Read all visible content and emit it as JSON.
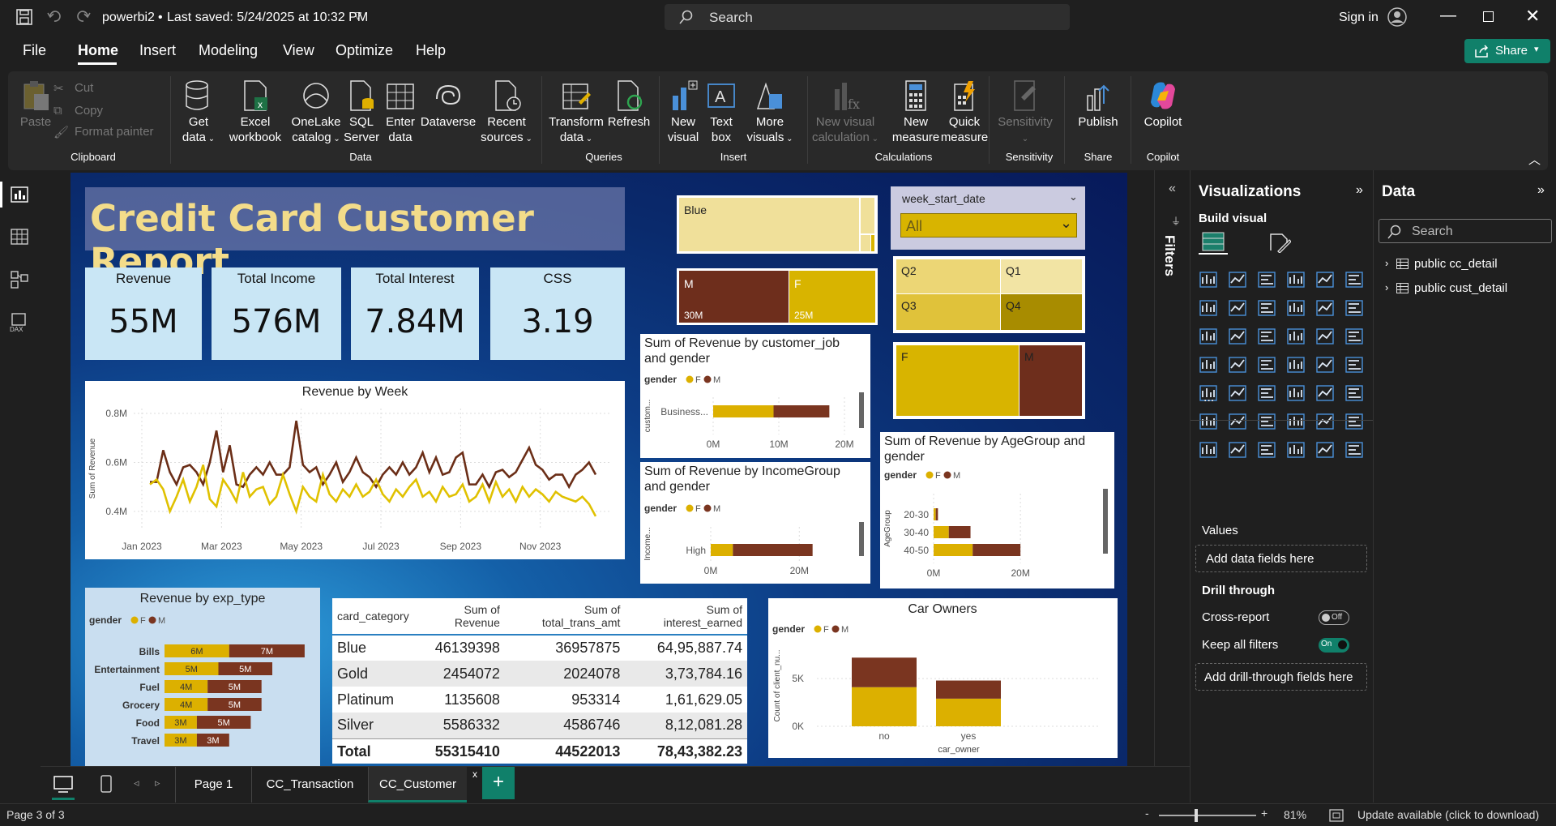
{
  "titlebar": {
    "file_name": "powerbi2",
    "saved": "Last saved: 5/24/2025 at 10:32 PM",
    "search_placeholder": "Search",
    "sign_in": "Sign in"
  },
  "menu": {
    "items": [
      "File",
      "Home",
      "Insert",
      "Modeling",
      "View",
      "Optimize",
      "Help"
    ],
    "active": "Home",
    "share": "Share"
  },
  "ribbon": {
    "clipboard": {
      "paste": "Paste",
      "cut": "Cut",
      "copy": "Copy",
      "format_painter": "Format painter",
      "group": "Clipboard"
    },
    "data": {
      "get_data_1": "Get",
      "get_data_2": "data",
      "excel_1": "Excel",
      "excel_2": "workbook",
      "onelake_1": "OneLake",
      "onelake_2": "catalog",
      "sql_1": "SQL",
      "sql_2": "Server",
      "enter_1": "Enter",
      "enter_2": "data",
      "dataverse": "Dataverse",
      "recent_1": "Recent",
      "recent_2": "sources",
      "group": "Data"
    },
    "queries": {
      "transform_1": "Transform",
      "transform_2": "data",
      "refresh": "Refresh",
      "group": "Queries"
    },
    "insert": {
      "new_visual_1": "New",
      "new_visual_2": "visual",
      "text_box_1": "Text",
      "text_box_2": "box",
      "more_1": "More",
      "more_2": "visuals",
      "group": "Insert"
    },
    "calculations": {
      "nvc_1": "New visual",
      "nvc_2": "calculation",
      "nm_1": "New",
      "nm_2": "measure",
      "qm_1": "Quick",
      "qm_2": "measure",
      "group": "Calculations"
    },
    "sensitivity": {
      "label": "Sensitivity",
      "group": "Sensitivity"
    },
    "share": {
      "publish": "Publish",
      "group": "Share"
    },
    "copilot": {
      "label": "Copilot",
      "group": "Copilot"
    }
  },
  "report": {
    "title": "Credit Card Customer Report",
    "cards": [
      {
        "label": "Revenue",
        "value": "55M"
      },
      {
        "label": "Total Income",
        "value": "576M"
      },
      {
        "label": "Total Interest",
        "value": "7.84M"
      },
      {
        "label": "CSS",
        "value": "3.19"
      }
    ],
    "slicer": {
      "title": "week_start_date",
      "value": "All"
    },
    "treemap_card": {
      "label": "Blue"
    },
    "treemap_gender": {
      "m_label": "M",
      "m_value": "30M",
      "f_label": "F",
      "f_value": "25M"
    },
    "treemap_quarter": {
      "q2": "Q2",
      "q1": "Q1",
      "q3": "Q3",
      "q4": "Q4"
    },
    "treemap_gender2": {
      "f": "F",
      "m": "M"
    },
    "legend": {
      "label": "gender",
      "f": "F",
      "m": "M"
    }
  },
  "chart_data": [
    {
      "type": "line",
      "title": "Revenue by Week",
      "xlabel": "",
      "ylabel": "Sum of Revenue",
      "x_ticks": [
        "Jan 2023",
        "Mar 2023",
        "May 2023",
        "Jul 2023",
        "Sep 2023",
        "Nov 2023"
      ],
      "y_ticks": [
        "0.4M",
        "0.6M",
        "0.8M"
      ],
      "ylim": [
        0.33,
        0.82
      ],
      "series": [
        {
          "name": "M",
          "color": "#6b2e17",
          "values": [
            0.52,
            0.52,
            0.65,
            0.56,
            0.51,
            0.58,
            0.59,
            0.56,
            0.51,
            0.6,
            0.73,
            0.56,
            0.67,
            0.51,
            0.5,
            0.55,
            0.58,
            0.55,
            0.6,
            0.55,
            0.55,
            0.58,
            0.77,
            0.59,
            0.56,
            0.58,
            0.51,
            0.55,
            0.6,
            0.52,
            0.56,
            0.62,
            0.56,
            0.54,
            0.5,
            0.55,
            0.58,
            0.55,
            0.6,
            0.55,
            0.58,
            0.64,
            0.56,
            0.62,
            0.55,
            0.56,
            0.62,
            0.64,
            0.51,
            0.51,
            0.55,
            0.5,
            0.56,
            0.57,
            0.54,
            0.56,
            0.61,
            0.66,
            0.59,
            0.57,
            0.53,
            0.55,
            0.55,
            0.5,
            0.55,
            0.57,
            0.6,
            0.55
          ]
        },
        {
          "name": "F",
          "color": "#e0c100",
          "values": [
            0.51,
            0.53,
            0.49,
            0.4,
            0.46,
            0.53,
            0.44,
            0.5,
            0.59,
            0.45,
            0.42,
            0.53,
            0.49,
            0.44,
            0.56,
            0.46,
            0.49,
            0.5,
            0.43,
            0.46,
            0.55,
            0.47,
            0.4,
            0.5,
            0.46,
            0.44,
            0.55,
            0.47,
            0.44,
            0.49,
            0.46,
            0.51,
            0.46,
            0.48,
            0.53,
            0.47,
            0.44,
            0.49,
            0.46,
            0.5,
            0.53,
            0.46,
            0.48,
            0.44,
            0.5,
            0.46,
            0.47,
            0.51,
            0.44,
            0.46,
            0.51,
            0.44,
            0.52,
            0.46,
            0.49,
            0.44,
            0.5,
            0.46,
            0.49,
            0.47,
            0.44,
            0.48,
            0.46,
            0.45,
            0.44,
            0.46,
            0.43,
            0.38
          ]
        }
      ]
    },
    {
      "type": "bar",
      "title": "Sum of Revenue by customer_job and gender",
      "ylabel": "custom...",
      "categories": [
        "Business..."
      ],
      "x_ticks": [
        "0M",
        "10M",
        "20M"
      ],
      "xlim": [
        0,
        20
      ],
      "series": [
        {
          "name": "F",
          "values": [
            9.2
          ]
        },
        {
          "name": "M",
          "values": [
            8.5
          ]
        }
      ]
    },
    {
      "type": "bar",
      "title": "Sum of Revenue by IncomeGroup and gender",
      "ylabel": "Income...",
      "categories": [
        "High"
      ],
      "x_ticks": [
        "0M",
        "20M"
      ],
      "xlim": [
        0,
        28
      ],
      "series": [
        {
          "name": "F",
          "values": [
            5
          ]
        },
        {
          "name": "M",
          "values": [
            18
          ]
        }
      ]
    },
    {
      "type": "bar",
      "title": "Sum of Revenue by AgeGroup and gender",
      "ylabel": "AgeGroup",
      "categories": [
        "20-30",
        "30-40",
        "40-50"
      ],
      "x_ticks": [
        "0M",
        "20M"
      ],
      "xlim": [
        0,
        28
      ],
      "series": [
        {
          "name": "F",
          "values": [
            0.5,
            3.5,
            9
          ]
        },
        {
          "name": "M",
          "values": [
            0.5,
            5,
            11
          ]
        }
      ]
    },
    {
      "type": "bar",
      "title": "Revenue by exp_type",
      "categories": [
        "Bills",
        "Entertainment",
        "Fuel",
        "Grocery",
        "Food",
        "Travel"
      ],
      "series": [
        {
          "name": "F",
          "values": [
            6,
            5,
            4,
            4,
            3,
            3
          ],
          "labels": [
            "6M",
            "5M",
            "4M",
            "4M",
            "3M",
            "3M"
          ]
        },
        {
          "name": "M",
          "values": [
            7,
            5,
            5,
            5,
            5,
            3
          ],
          "labels": [
            "7M",
            "5M",
            "5M",
            "5M",
            "5M",
            "3M"
          ]
        }
      ]
    },
    {
      "type": "table",
      "columns": [
        "card_category",
        "Sum of Revenue",
        "Sum of total_trans_amt",
        "Sum of interest_earned"
      ],
      "rows": [
        [
          "Blue",
          "46139398",
          "36957875",
          "64,95,887.74"
        ],
        [
          "Gold",
          "2454072",
          "2024078",
          "3,73,784.16"
        ],
        [
          "Platinum",
          "1135608",
          "953314",
          "1,61,629.05"
        ],
        [
          "Silver",
          "5586332",
          "4586746",
          "8,12,081.28"
        ]
      ],
      "total": [
        "Total",
        "55315410",
        "44522013",
        "78,43,382.23"
      ]
    },
    {
      "type": "bar",
      "title": "Car Owners",
      "xlabel": "car_owner",
      "ylabel": "Count of client_nu...",
      "categories": [
        "no",
        "yes"
      ],
      "y_ticks": [
        "0K",
        "5K"
      ],
      "ylim": [
        0,
        8.5
      ],
      "series": [
        {
          "name": "F",
          "values": [
            4.1,
            2.9
          ]
        },
        {
          "name": "M",
          "values": [
            3.1,
            1.9
          ]
        }
      ]
    }
  ],
  "filters": {
    "label": "Filters"
  },
  "viz_pane": {
    "title": "Visualizations",
    "build": "Build visual",
    "values": "Values",
    "add_data": "Add data fields here",
    "drill": "Drill through",
    "cross": "Cross-report",
    "cross_state": "Off",
    "keep": "Keep all filters",
    "keep_state": "On",
    "add_drill": "Add drill-through fields here",
    "more": "..."
  },
  "data_pane": {
    "title": "Data",
    "search": "Search",
    "tables": [
      "public cc_detail",
      "public cust_detail"
    ]
  },
  "pages": {
    "tabs": [
      "Page 1",
      "CC_Transaction",
      "CC_Customer"
    ],
    "active": "CC_Customer",
    "add": "+",
    "close": "x"
  },
  "status": {
    "page": "Page 3 of 3",
    "zoom": "81%",
    "update": "Update available (click to download)",
    "minus": "-",
    "plus": "+"
  }
}
